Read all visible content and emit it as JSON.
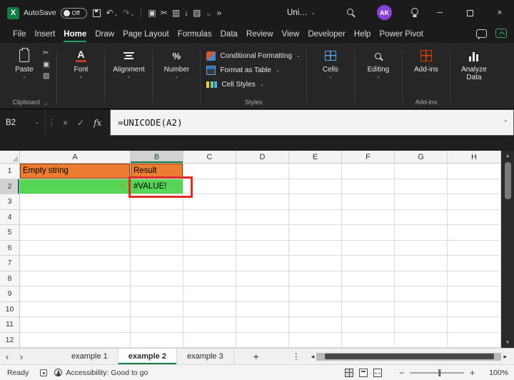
{
  "icons": {
    "logo": "X",
    "minimize": "─",
    "x": "×",
    "check": "✓",
    "chevron_down": "⌄",
    "chevron_up": "⌃",
    "more": "»",
    "undo": "↶",
    "redo": "↷",
    "dots_v": "⋮",
    "cut": "✂",
    "copy": "▣",
    "chart": "▥",
    "sort": "↓",
    "paint": "▨",
    "fx": "fx",
    "font_a": "A",
    "percent": "%",
    "warning": "⚠",
    "tab_prev": "‹",
    "tab_next": "›",
    "plus": "+",
    "minus": "−",
    "launcher": "⌟",
    "left": "◂",
    "right": "▸",
    "up": "▴",
    "down": "▾"
  },
  "titlebar": {
    "autosave_label": "AutoSave",
    "autosave_state": "Off",
    "doc_title": "Uni…",
    "avatar_initials": "AK"
  },
  "menubar": {
    "items": [
      "File",
      "Insert",
      "Home",
      "Draw",
      "Page Layout",
      "Formulas",
      "Data",
      "Review",
      "View",
      "Developer",
      "Help",
      "Power Pivot"
    ],
    "active": "Home"
  },
  "ribbon": {
    "paste_label": "Paste",
    "buttons": {
      "font": "Font",
      "alignment": "Alignment",
      "number": "Number",
      "cells": "Cells",
      "editing": "Editing",
      "addins": "Add-ins",
      "analyze": "Analyze Data"
    },
    "styles_items": [
      "Conditional Formatting",
      "Format as Table",
      "Cell Styles"
    ],
    "group_labels": {
      "clipboard": "Clipboard",
      "styles": "Styles",
      "addins": "Add-ins"
    }
  },
  "formula_bar": {
    "name_box": "B2",
    "formula": "=UNICODE(A2)"
  },
  "grid": {
    "columns": [
      "A",
      "B",
      "C",
      "D",
      "E",
      "F",
      "G",
      "H"
    ],
    "rows": [
      "1",
      "2",
      "3",
      "4",
      "5",
      "6",
      "7",
      "8",
      "9",
      "10",
      "11",
      "12"
    ],
    "cells": {
      "A1": "Empty string",
      "B1": "Result",
      "B2": "#VALUE!"
    },
    "fills": {
      "A1": "orange",
      "B1": "orange",
      "A2": "green",
      "B2": "green"
    },
    "selected_column": "B",
    "selected_row": "2",
    "active_cell": "B2",
    "warning_cell": "A2"
  },
  "sheet_tabs": {
    "tabs": [
      "example 1",
      "example 2",
      "example 3"
    ],
    "active": "example 2"
  },
  "status_bar": {
    "ready": "Ready",
    "accessibility": "Accessibility: Good to go",
    "zoom": "100%"
  },
  "colors": {
    "accent_green": "#107C41",
    "fill_orange": "#ED7D31",
    "fill_green": "#55D455",
    "annotation_red": "#E02B2B",
    "avatar_purple": "#8A40D8"
  }
}
